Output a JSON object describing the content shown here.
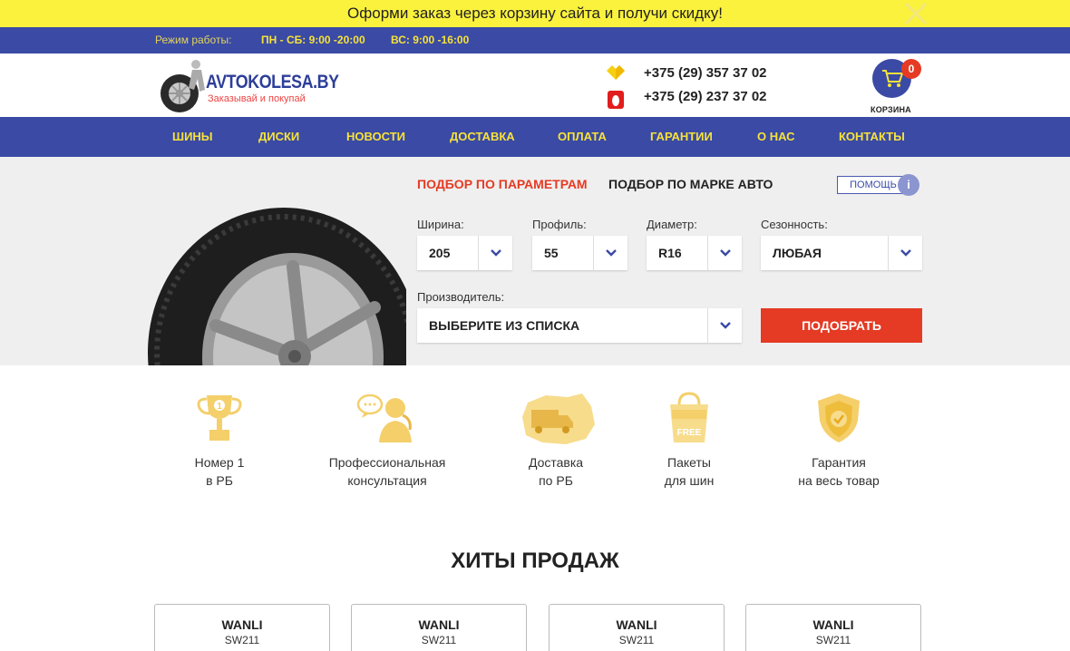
{
  "promo": {
    "text": "Оформи заказ через корзину сайта и получи скидку!"
  },
  "hours": {
    "label": "Режим работы:",
    "weekdays": "ПН - СБ: 9:00 -20:00",
    "weekend": "ВС: 9:00 -16:00"
  },
  "header": {
    "logo_name": "AVTOKOLESA.BY",
    "logo_tagline": "Заказывай и покупай",
    "phones": [
      {
        "icon": "velcom-icon",
        "number": "+375 (29) 357 37 02"
      },
      {
        "icon": "mts-icon",
        "number": "+375 (29) 237 37 02"
      }
    ],
    "cart_count": "0",
    "cart_label": "КОРЗИНА"
  },
  "nav": [
    "ШИНЫ",
    "ДИСКИ",
    "НОВОСТИ",
    "ДОСТАВКА",
    "ОПЛАТА",
    "ГАРАНТИИ",
    "О НАС",
    "КОНТАКТЫ"
  ],
  "selector": {
    "tab_active": "ПОДБОР ПО ПАРАМЕТРАМ",
    "tab_inactive": "ПОДБОР ПО МАРКЕ АВТО",
    "help": "ПОМОЩЬ",
    "help_icon": "i",
    "width_label": "Ширина:",
    "width_value": "205",
    "profile_label": "Профиль:",
    "profile_value": "55",
    "diameter_label": "Диаметр:",
    "diameter_value": "R16",
    "season_label": "Сезонность:",
    "season_value": "ЛЮБАЯ",
    "maker_label": "Производитель:",
    "maker_value": "ВЫБЕРИТЕ ИЗ СПИСКА",
    "submit": "ПОДОБРАТЬ"
  },
  "features": [
    {
      "icon": "trophy-icon",
      "line1": "Номер 1",
      "line2": "в РБ"
    },
    {
      "icon": "consultant-icon",
      "line1": "Профессиональная",
      "line2": "консультация"
    },
    {
      "icon": "delivery-truck-icon",
      "line1": "Доставка",
      "line2": "по РБ"
    },
    {
      "icon": "free-bag-icon",
      "bag_text": "FREE",
      "line1": "Пакеты",
      "line2": "для шин"
    },
    {
      "icon": "shield-check-icon",
      "line1": "Гарантия",
      "line2": "на весь товар"
    }
  ],
  "hits": {
    "title": "ХИТЫ ПРОДАЖ",
    "cards": [
      {
        "brand": "WANLI",
        "model": "SW211"
      },
      {
        "brand": "WANLI",
        "model": "SW211"
      },
      {
        "brand": "WANLI",
        "model": "SW211"
      },
      {
        "brand": "WANLI",
        "model": "SW211"
      }
    ]
  },
  "colors": {
    "blue": "#3a4aa5",
    "yellow": "#f6e23a",
    "red": "#e53a23",
    "promo": "#fbf23e"
  }
}
